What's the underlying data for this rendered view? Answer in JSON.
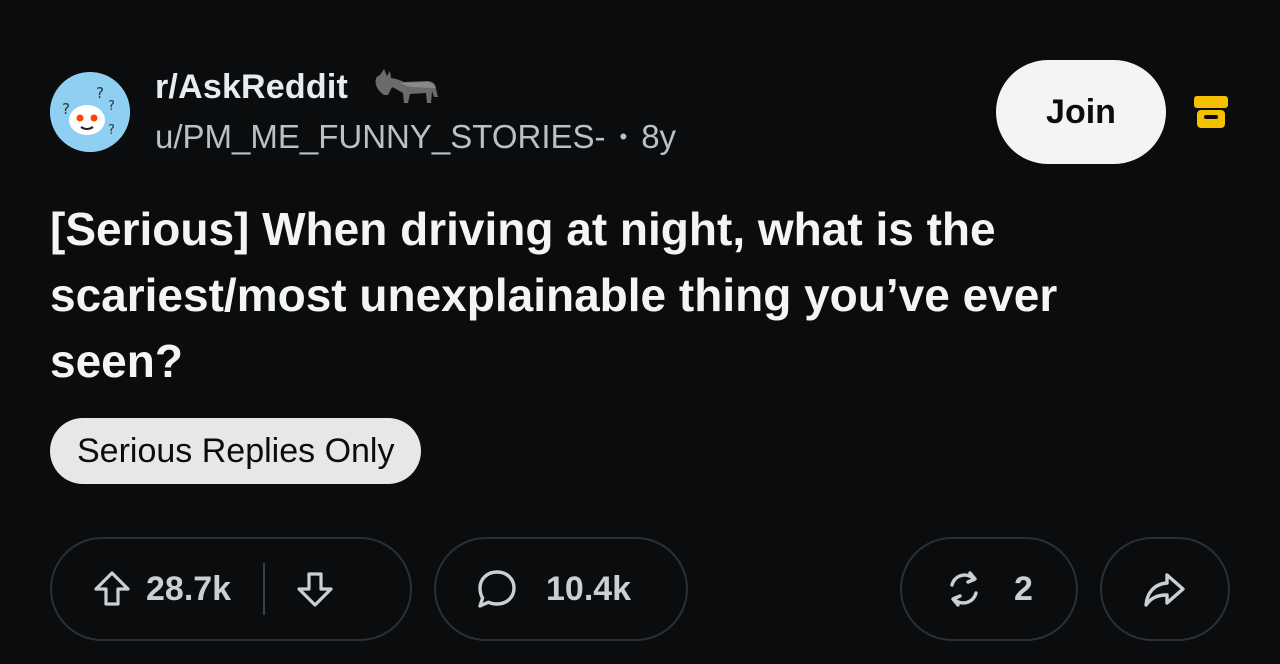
{
  "post": {
    "subreddit": "r/AskReddit",
    "username": "u/PM_ME_FUNNY_STORIES-",
    "age": "8y",
    "join_label": "Join",
    "title": "[Serious] When driving at night, what is the scariest/most unexplainable thing you’ve ever seen?",
    "flair": "Serious Replies Only"
  },
  "actions": {
    "upvotes": "28.7k",
    "comments": "10.4k",
    "shares": "2"
  },
  "icons": {
    "avatar": "subreddit-avatar-icon",
    "user_flair": "donkey-flair-icon",
    "mod": "archive-icon",
    "upvote": "arrow-up-icon",
    "downvote": "arrow-down-icon",
    "comment": "comment-bubble-icon",
    "crosspost": "crosspost-icon",
    "share": "share-arrow-icon"
  },
  "colors": {
    "background": "#0b0c0e",
    "join_button": "#f2f4f5",
    "mod_icon": "#f5c000",
    "flair_bg": "#e5e7e9",
    "avatar_bg": "#8fcff2"
  }
}
